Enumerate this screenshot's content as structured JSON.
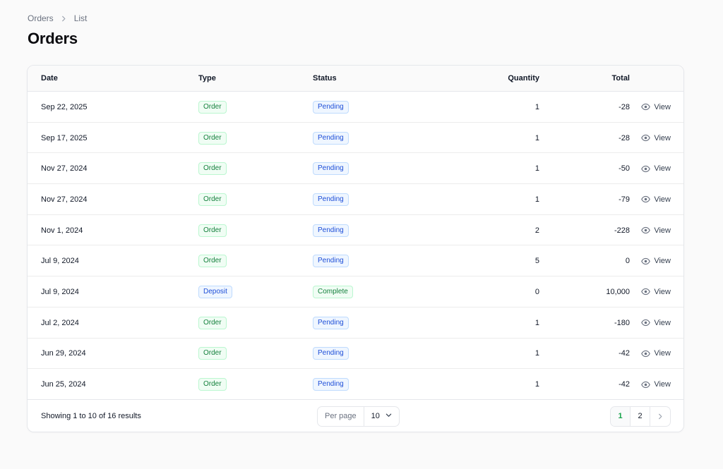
{
  "breadcrumb": {
    "items": [
      "Orders",
      "List"
    ]
  },
  "page": {
    "title": "Orders"
  },
  "table": {
    "columns": {
      "date": "Date",
      "type": "Type",
      "status": "Status",
      "quantity": "Quantity",
      "total": "Total"
    },
    "view_label": "View",
    "rows": [
      {
        "date": "Sep 22, 2025",
        "type": "Order",
        "status": "Pending",
        "quantity": "1",
        "total": "-28"
      },
      {
        "date": "Sep 17, 2025",
        "type": "Order",
        "status": "Pending",
        "quantity": "1",
        "total": "-28"
      },
      {
        "date": "Nov 27, 2024",
        "type": "Order",
        "status": "Pending",
        "quantity": "1",
        "total": "-50"
      },
      {
        "date": "Nov 27, 2024",
        "type": "Order",
        "status": "Pending",
        "quantity": "1",
        "total": "-79"
      },
      {
        "date": "Nov 1, 2024",
        "type": "Order",
        "status": "Pending",
        "quantity": "2",
        "total": "-228"
      },
      {
        "date": "Jul 9, 2024",
        "type": "Order",
        "status": "Pending",
        "quantity": "5",
        "total": "0"
      },
      {
        "date": "Jul 9, 2024",
        "type": "Deposit",
        "status": "Complete",
        "quantity": "0",
        "total": "10,000"
      },
      {
        "date": "Jul 2, 2024",
        "type": "Order",
        "status": "Pending",
        "quantity": "1",
        "total": "-180"
      },
      {
        "date": "Jun 29, 2024",
        "type": "Order",
        "status": "Pending",
        "quantity": "1",
        "total": "-42"
      },
      {
        "date": "Jun 25, 2024",
        "type": "Order",
        "status": "Pending",
        "quantity": "1",
        "total": "-42"
      }
    ]
  },
  "footer": {
    "results_text": "Showing 1 to 10 of 16 results",
    "per_page_label": "Per page",
    "per_page_value": "10",
    "pages": [
      "1",
      "2"
    ],
    "current_page": "1"
  },
  "colors": {
    "green_text": "#15803d",
    "green_bg": "#f0fdf4",
    "green_border": "#bbf7d0",
    "blue_text": "#1d4ed8",
    "blue_bg": "#eff6ff",
    "blue_border": "#bfdbfe"
  },
  "icons": {
    "breadcrumb_sep": "chevron-right-icon",
    "view": "eye-icon",
    "select": "chevron-down-icon",
    "next": "chevron-right-icon"
  }
}
